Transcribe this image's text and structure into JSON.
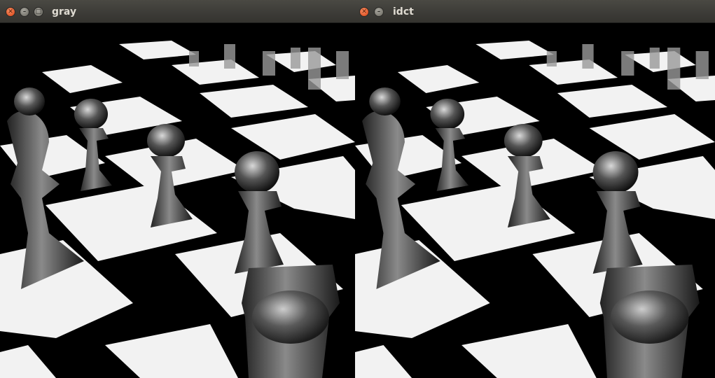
{
  "windows": [
    {
      "title": "gray",
      "buttons": [
        "close-icon",
        "minimize-icon",
        "maximize-icon"
      ]
    },
    {
      "title": "idct",
      "buttons": [
        "close-icon",
        "minimize-icon"
      ]
    }
  ],
  "image": {
    "subject": "chess pieces on a glossy black and white checkerboard",
    "colors": [
      "#000000",
      "#ffffff"
    ]
  }
}
